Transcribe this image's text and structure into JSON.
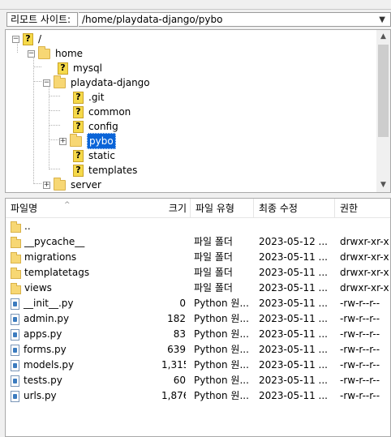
{
  "path_bar": {
    "label": "리모트 사이트:",
    "path": "/home/playdata-django/pybo",
    "dropdown_icon": "chevron-down-icon"
  },
  "tree": {
    "nodes": [
      {
        "label": "/",
        "icon": "question-icon",
        "expander": "−"
      },
      {
        "label": "home",
        "icon": "folder-icon",
        "expander": "−"
      },
      {
        "label": "mysql",
        "icon": "question-icon",
        "expander": ""
      },
      {
        "label": "playdata-django",
        "icon": "folder-icon",
        "expander": "−"
      },
      {
        "label": ".git",
        "icon": "question-icon",
        "expander": ""
      },
      {
        "label": "common",
        "icon": "question-icon",
        "expander": ""
      },
      {
        "label": "config",
        "icon": "question-icon",
        "expander": ""
      },
      {
        "label": "pybo",
        "icon": "folder-icon",
        "expander": "+",
        "selected": true
      },
      {
        "label": "static",
        "icon": "question-icon",
        "expander": ""
      },
      {
        "label": "templates",
        "icon": "question-icon",
        "expander": ""
      },
      {
        "label": "server",
        "icon": "folder-icon",
        "expander": "+"
      }
    ],
    "scroll_up": "▲",
    "scroll_down": "▼"
  },
  "filelist": {
    "headers": {
      "name": "파일명",
      "size": "크기",
      "type": "파일 유형",
      "modified": "최종 수정",
      "perms": "권한",
      "sort_arrow": "^"
    },
    "rows": [
      {
        "name": "..",
        "kind": "folder",
        "size": "",
        "type": "",
        "modified": "",
        "perms": ""
      },
      {
        "name": "__pycache__",
        "kind": "folder",
        "size": "",
        "type": "파일 폴더",
        "modified": "2023-05-12 ...",
        "perms": "drwxr-xr-x"
      },
      {
        "name": "migrations",
        "kind": "folder",
        "size": "",
        "type": "파일 폴더",
        "modified": "2023-05-11 ...",
        "perms": "drwxr-xr-x"
      },
      {
        "name": "templatetags",
        "kind": "folder",
        "size": "",
        "type": "파일 폴더",
        "modified": "2023-05-11 ...",
        "perms": "drwxr-xr-x"
      },
      {
        "name": "views",
        "kind": "folder",
        "size": "",
        "type": "파일 폴더",
        "modified": "2023-05-11 ...",
        "perms": "drwxr-xr-x"
      },
      {
        "name": "__init__.py",
        "kind": "py",
        "size": "0",
        "type": "Python 원...",
        "modified": "2023-05-11 ...",
        "perms": "-rw-r--r--"
      },
      {
        "name": "admin.py",
        "kind": "py",
        "size": "182",
        "type": "Python 원...",
        "modified": "2023-05-11 ...",
        "perms": "-rw-r--r--"
      },
      {
        "name": "apps.py",
        "kind": "py",
        "size": "83",
        "type": "Python 원...",
        "modified": "2023-05-11 ...",
        "perms": "-rw-r--r--"
      },
      {
        "name": "forms.py",
        "kind": "py",
        "size": "639",
        "type": "Python 원...",
        "modified": "2023-05-11 ...",
        "perms": "-rw-r--r--"
      },
      {
        "name": "models.py",
        "kind": "py",
        "size": "1,315",
        "type": "Python 원...",
        "modified": "2023-05-11 ...",
        "perms": "-rw-r--r--"
      },
      {
        "name": "tests.py",
        "kind": "py",
        "size": "60",
        "type": "Python 원...",
        "modified": "2023-05-11 ...",
        "perms": "-rw-r--r--"
      },
      {
        "name": "urls.py",
        "kind": "py",
        "size": "1,876",
        "type": "Python 원...",
        "modified": "2023-05-11 ...",
        "perms": "-rw-r--r--"
      }
    ]
  },
  "colors": {
    "selection": "#0a64d8",
    "folder": "#f7d774",
    "unknown": "#f5d94a"
  }
}
